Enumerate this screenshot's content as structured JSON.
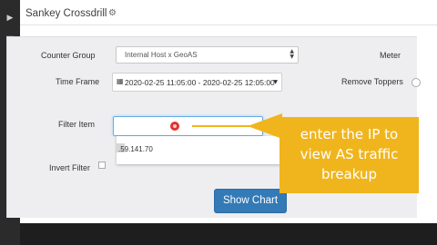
{
  "panel": {
    "title": "Sankey Crossdrill",
    "gear_icon": "gear-icon"
  },
  "form": {
    "counter_group": {
      "label": "Counter Group",
      "value": "Internal Host x GeoAS"
    },
    "meter": {
      "label": "Meter"
    },
    "time_frame": {
      "label": "Time Frame",
      "value": "2020-02-25 11:05:00 - 2020-02-25 12:05:00"
    },
    "remove_toppers": {
      "label": "Remove Toppers"
    },
    "filter_item": {
      "label": "Filter Item",
      "dropdown_option": ".59.141.70"
    },
    "partial_label": "s",
    "invert_filter": {
      "label": "Invert Filter"
    },
    "show_chart_label": "Show Chart"
  },
  "callout": {
    "lines": [
      "enter the IP to",
      "view AS traffic",
      "breakup"
    ]
  },
  "colors": {
    "primary_button": "#337ab7",
    "callout": "#f0b51d",
    "record_dot": "#e0332e",
    "sidebar": "#2b2b2b"
  }
}
